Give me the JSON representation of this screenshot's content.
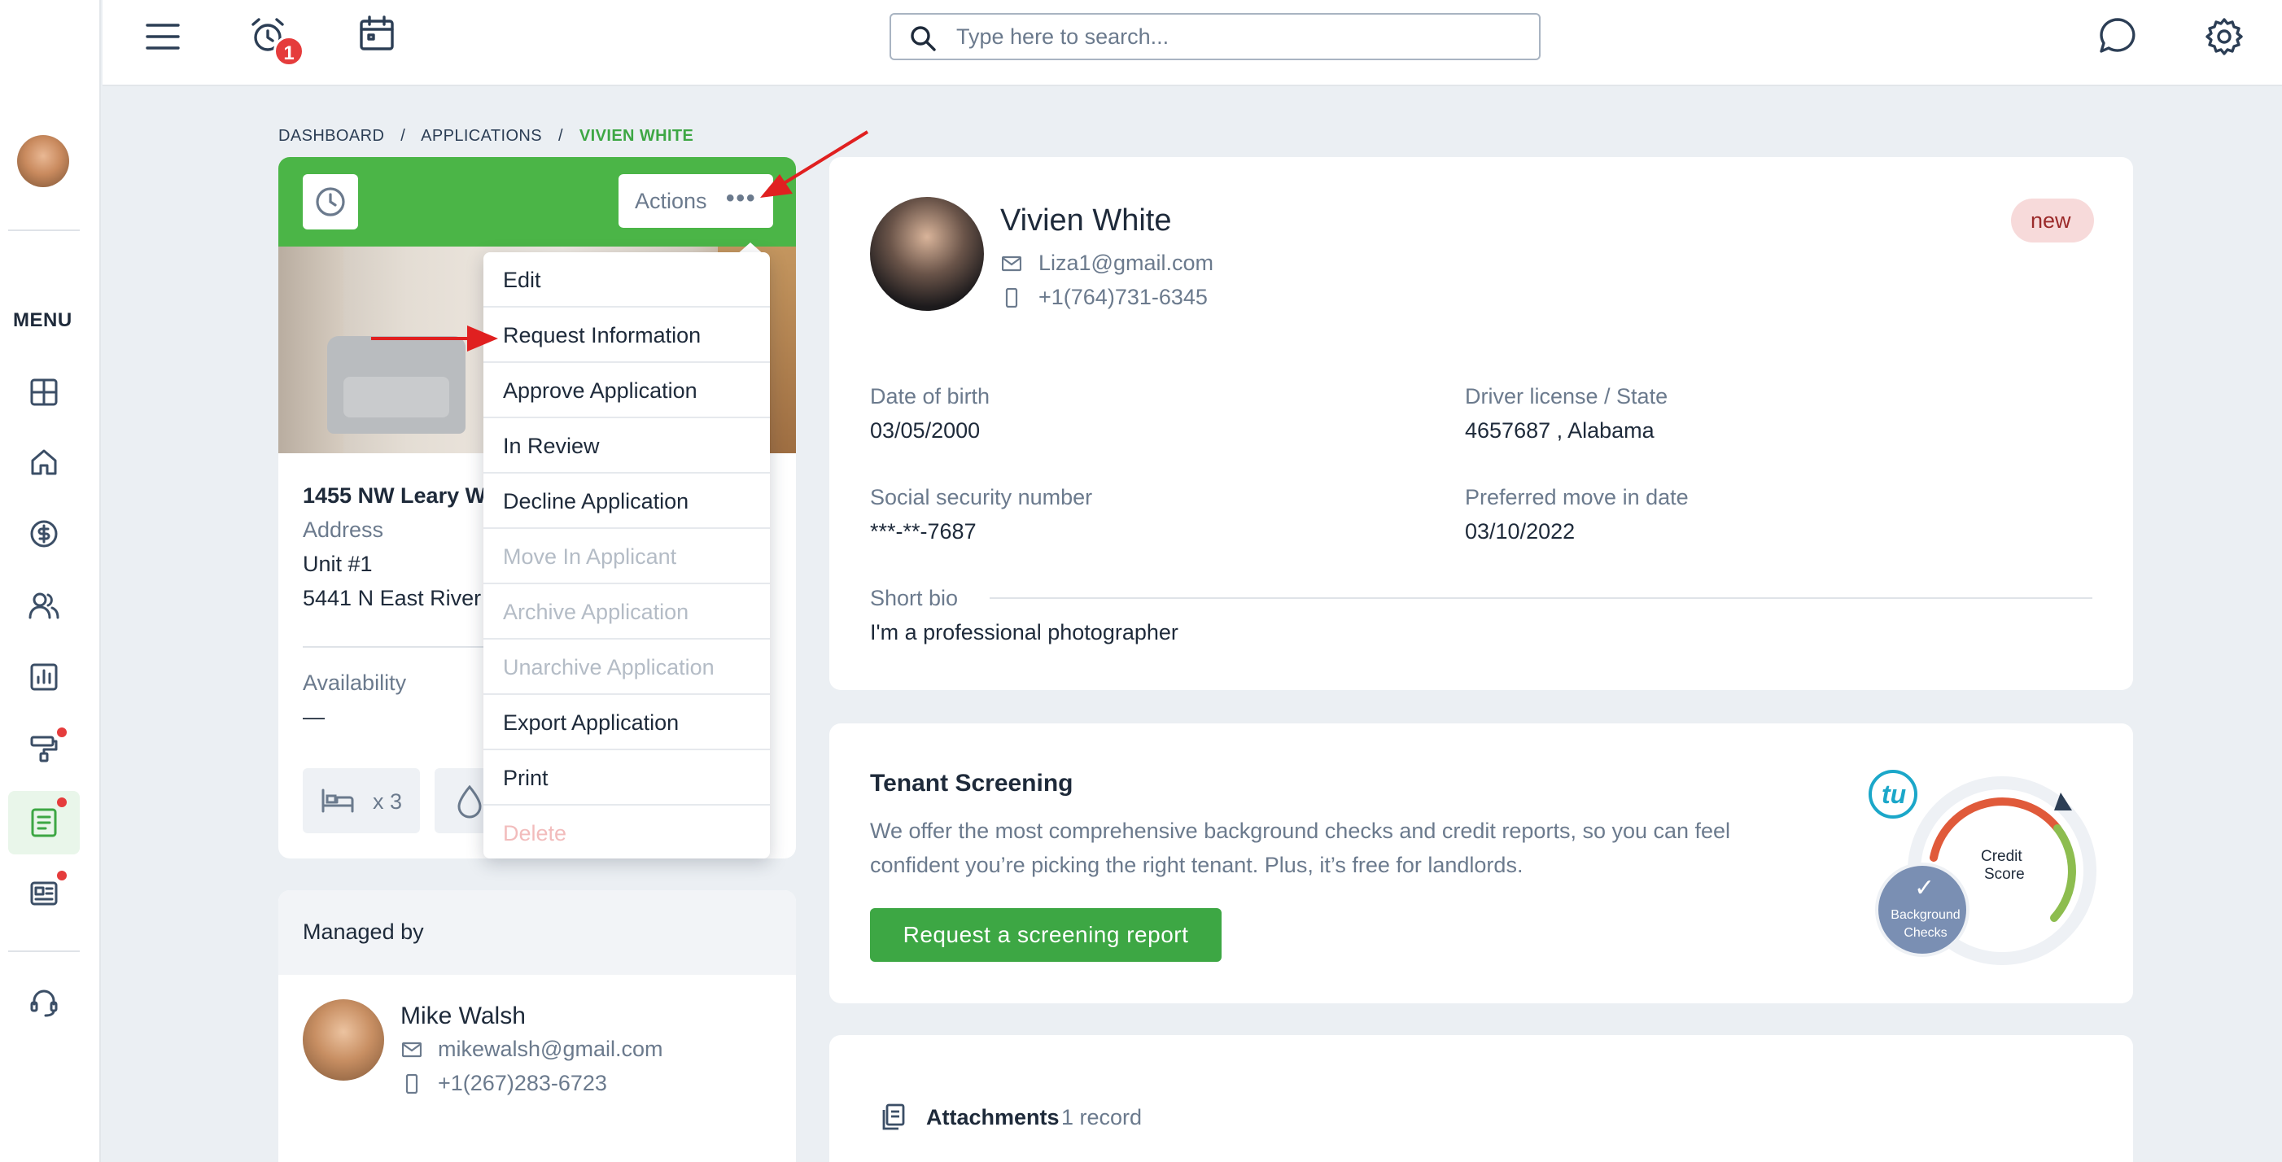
{
  "topbar": {
    "search_placeholder": "Type here to search...",
    "notification_count": "1"
  },
  "sidebar": {
    "menu_label": "MENU"
  },
  "breadcrumb": {
    "items": [
      "DASHBOARD",
      "APPLICATIONS",
      "VIVIEN WHITE"
    ],
    "separator": "/"
  },
  "property_card": {
    "actions_label": "Actions",
    "address_line": "1455 NW Leary Wa",
    "address_label": "Address",
    "unit": "Unit #1",
    "street": "5441 N East River",
    "availability_label": "Availability",
    "availability_value": "—",
    "beds": "x 3"
  },
  "actions_menu": {
    "items": [
      {
        "label": "Edit",
        "state": "enabled"
      },
      {
        "label": "Request Information",
        "state": "enabled"
      },
      {
        "label": "Approve Application",
        "state": "enabled"
      },
      {
        "label": "In Review",
        "state": "enabled"
      },
      {
        "label": "Decline Application",
        "state": "enabled"
      },
      {
        "label": "Move In Applicant",
        "state": "disabled"
      },
      {
        "label": "Archive Application",
        "state": "disabled"
      },
      {
        "label": "Unarchive Application",
        "state": "disabled"
      },
      {
        "label": "Export Application",
        "state": "enabled"
      },
      {
        "label": "Print",
        "state": "enabled"
      },
      {
        "label": "Delete",
        "state": "disabled-danger"
      }
    ]
  },
  "managed_by": {
    "title": "Managed by",
    "name": "Mike Walsh",
    "email": "mikewalsh@gmail.com",
    "phone": "+1(267)283-6723"
  },
  "applicant": {
    "name": "Vivien White",
    "email": "Liza1@gmail.com",
    "phone": "+1(764)731-6345",
    "status": "new",
    "dob_label": "Date of birth",
    "dob": "03/05/2000",
    "license_label": "Driver license / State",
    "license": "4657687 , Alabama",
    "ssn_label": "Social security number",
    "ssn": "***-**-7687",
    "move_in_label": "Preferred move in date",
    "move_in": "03/10/2022",
    "bio_label": "Short bio",
    "bio": "I'm a professional photographer"
  },
  "screening": {
    "title": "Tenant Screening",
    "line1": "We offer the most comprehensive background checks and credit reports, so you can feel",
    "line2": "confident you’re picking the right tenant. Plus, it’s free for landlords.",
    "button": "Request a screening report",
    "logo_text": "tu",
    "credit_score_line1": "Credit",
    "credit_score_line2": "Score",
    "bg_checks_line1": "Background",
    "bg_checks_line2": "Checks"
  },
  "attachments": {
    "title": "Attachments",
    "count": "1 record"
  },
  "colors": {
    "accent_green": "#3da744",
    "header_green": "#4bb547",
    "alert_red": "#e53c3c",
    "status_new_bg": "#f7dada"
  }
}
